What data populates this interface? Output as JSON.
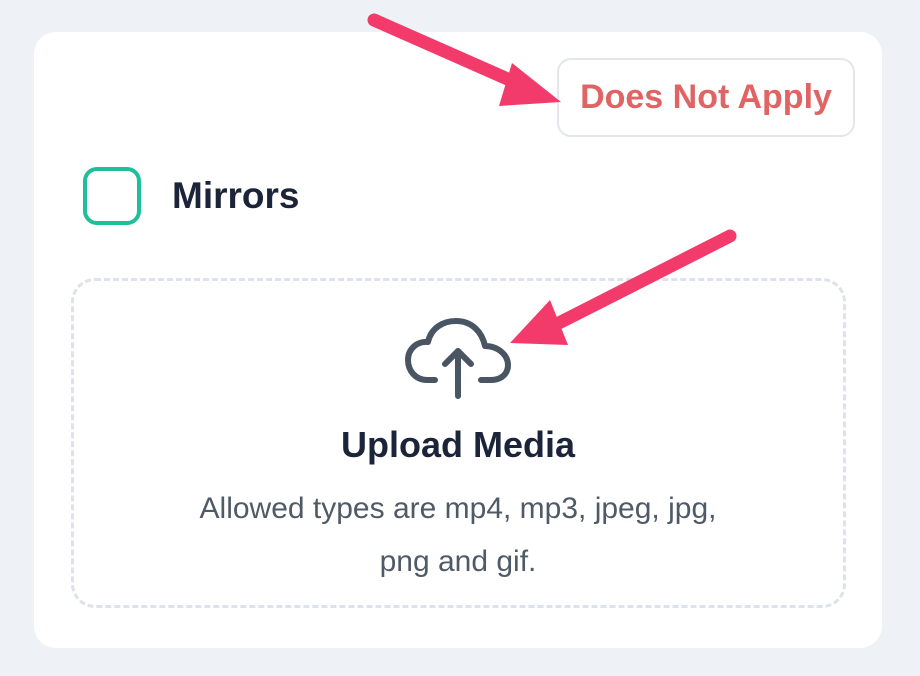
{
  "card": {
    "does_not_apply_label": "Does Not Apply",
    "item_label": "Mirrors",
    "checkbox_checked": false
  },
  "upload": {
    "icon": "cloud-upload-icon",
    "title": "Upload Media",
    "hint": "Allowed types are mp4, mp3, jpeg, jpg, png and gif."
  },
  "colors": {
    "page_background": "#eef2f7",
    "card_background": "#ffffff",
    "danger_text": "#e06464",
    "checkbox_border": "#1fbf9c",
    "heading_text": "#1b2438",
    "body_text": "#4f5a67",
    "annotation_arrow": "#f23b6b"
  },
  "annotations": [
    {
      "icon": "arrow-icon",
      "points_to": "does-not-apply-button"
    },
    {
      "icon": "arrow-icon",
      "points_to": "cloud-upload-icon"
    }
  ]
}
